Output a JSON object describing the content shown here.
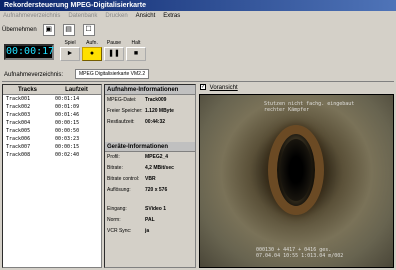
{
  "window": {
    "title": "Rekordersteuerung MPEG-Digitalisierkarte"
  },
  "menu": [
    {
      "label": "Aufnahmeverzeichnis",
      "disabled": true
    },
    {
      "label": "Datenbank",
      "disabled": true
    },
    {
      "label": "Drucken",
      "disabled": true
    },
    {
      "label": "Ansicht",
      "disabled": false
    },
    {
      "label": "Extras",
      "disabled": false
    }
  ],
  "toolbar": {
    "uebernehmen_label": "Übernehmen"
  },
  "counter": {
    "time": "00:00:17",
    "label": ""
  },
  "transport": {
    "spiel_label": "Spiel",
    "aufnahme_label": "Aufn.",
    "pause_label": "Pause",
    "halt_label": "Halt"
  },
  "source": {
    "label": "Aufnahmeverzeichnis:",
    "tab": "MPEG Digitalisierkarte VM2.2"
  },
  "tracks": {
    "headers": [
      "Tracks",
      "Laufzeit"
    ],
    "rows": [
      [
        "Track001",
        "00:01:14"
      ],
      [
        "Track002",
        "00:01:09"
      ],
      [
        "Track003",
        "00:01:46"
      ],
      [
        "Track004",
        "00:00:15"
      ],
      [
        "Track005",
        "00:00:50"
      ],
      [
        "Track006",
        "00:03:23"
      ],
      [
        "Track007",
        "00:00:15"
      ],
      [
        "Track008",
        "00:02:40"
      ]
    ]
  },
  "aufnahme": {
    "title": "Aufnahme-Informationen",
    "datei_label": "MPEG-Datei:",
    "datei": "Track009",
    "speicher_label": "Freier Speicher:",
    "speicher": "1.120 MByte",
    "restlaufzeit_label": "Restlaufzeit:",
    "restlaufzeit": "00:44:32"
  },
  "geraet": {
    "title": "Geräte-Informationen",
    "profil_label": "Profil:",
    "profil": "MPEG2_4",
    "bitrate_label": "Bitrate:",
    "bitrate": "4,2 MBit/sec",
    "bitrate_control_label": "Bitrate control:",
    "bitrate_control": "VBR",
    "aufloesung_label": "Auflösung:",
    "aufloesung": "720 x 576",
    "eingang_label": "Eingang:",
    "eingang": "SVideo 1",
    "norm_label": "Norm:",
    "norm": "PAL",
    "vcr_label": "VCR Sync:",
    "vcr": "ja"
  },
  "preview": {
    "label": "Voransicht",
    "osd_top": "Stutzen nicht fachg. eingebaut\nrechter Kämpfer",
    "osd_bottom": "000130 + 4417 + 0416 ges.\n07.04.04 10:55 1:013.04 m/002"
  }
}
